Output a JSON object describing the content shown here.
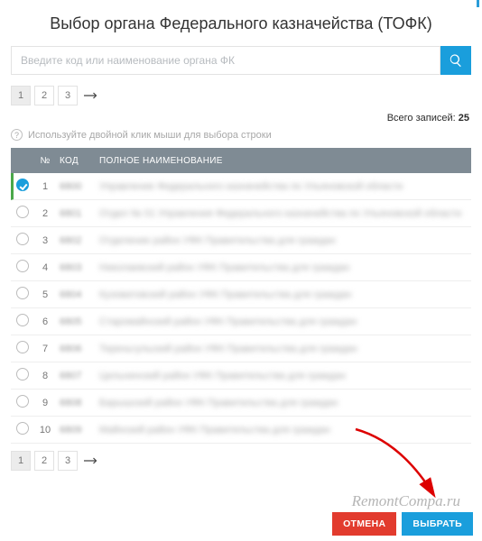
{
  "header": {
    "title": "Выбор органа Федерального казначейства (ТОФК)"
  },
  "search": {
    "placeholder": "Введите код или наименование органа ФК"
  },
  "pagination": {
    "pages": [
      "1",
      "2",
      "3"
    ],
    "active": 0,
    "next_icon": "arrow-right"
  },
  "total": {
    "label": "Всего записей:",
    "value": "25"
  },
  "hint": {
    "text": "Используйте двойной клик мыши для выбора строки"
  },
  "table": {
    "headers": {
      "num": "№",
      "code": "КОД",
      "name": "ПОЛНОЕ НАИМЕНОВАНИЕ"
    },
    "rows": [
      {
        "n": "1",
        "code": "6800",
        "name": "Управление Федерального казначейства по Ульяновской области",
        "selected": true
      },
      {
        "n": "2",
        "code": "6801",
        "name": "Отдел № 01 Управления Федерального казначейства по Ульяновской области",
        "selected": false
      },
      {
        "n": "3",
        "code": "6802",
        "name": "Отделение район УФК Правительства для граждан",
        "selected": false
      },
      {
        "n": "4",
        "code": "6803",
        "name": "Николаевский район УФК Правительства для граждан",
        "selected": false
      },
      {
        "n": "5",
        "code": "6804",
        "name": "Кузоватовский район УФК Правительства для граждан",
        "selected": false
      },
      {
        "n": "6",
        "code": "6805",
        "name": "Старомайнский район УФК Правительства для граждан",
        "selected": false
      },
      {
        "n": "7",
        "code": "6806",
        "name": "Тереньгульский район УФК Правительства для граждан",
        "selected": false
      },
      {
        "n": "8",
        "code": "6807",
        "name": "Цильнинский район УФК Правительства для граждан",
        "selected": false
      },
      {
        "n": "9",
        "code": "6808",
        "name": "Барышский район УФК Правительства для граждан",
        "selected": false
      },
      {
        "n": "10",
        "code": "6809",
        "name": "Майнский район УФК Правительства для граждан",
        "selected": false
      }
    ]
  },
  "footer": {
    "cancel": "ОТМЕНА",
    "select": "ВЫБРАТЬ"
  },
  "watermark": "RemontCompa.ru"
}
